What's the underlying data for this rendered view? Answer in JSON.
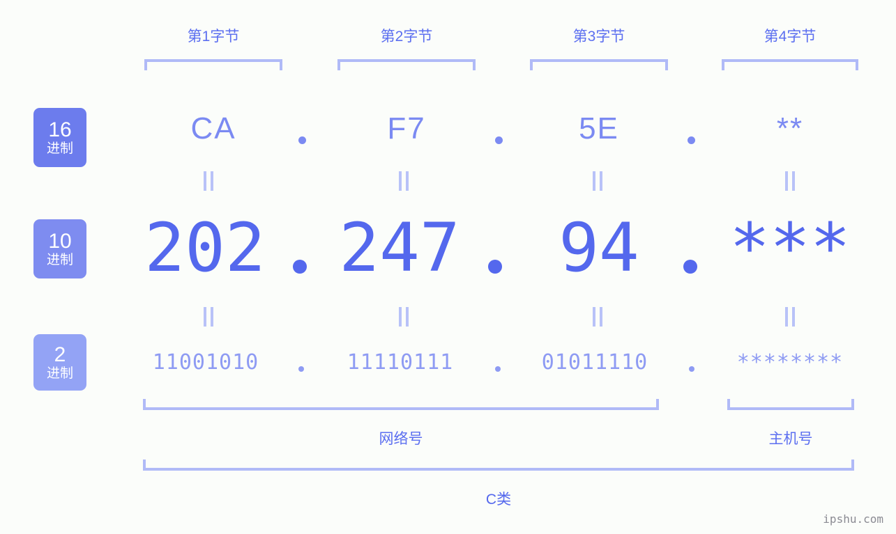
{
  "page": {
    "background_color": "#fbfdfa",
    "accent_color": "#5468ed",
    "light_accent_color": "#b0baf7",
    "watermark": "ipshu.com"
  },
  "byte_headers": [
    {
      "label": "第1字节"
    },
    {
      "label": "第2字节"
    },
    {
      "label": "第3字节"
    },
    {
      "label": "第4字节"
    }
  ],
  "rows": {
    "hex": {
      "badge_number": "16",
      "badge_unit": "进制",
      "badge_color": "#6c7ced",
      "values": [
        "CA",
        "F7",
        "5E",
        "**"
      ],
      "separator": "."
    },
    "dec": {
      "badge_number": "10",
      "badge_unit": "进制",
      "badge_color": "#7e8cf0",
      "values": [
        "202",
        "247",
        "94",
        "***"
      ],
      "separator": "."
    },
    "bin": {
      "badge_number": "2",
      "badge_unit": "进制",
      "badge_color": "#93a3f5",
      "values": [
        "11001010",
        "11110111",
        "01011110",
        "********"
      ],
      "separator": "."
    }
  },
  "equality_marks": {
    "symbol": "‖",
    "count_per_row": 4
  },
  "sections": [
    {
      "label": "网络号",
      "name": "network-part"
    },
    {
      "label": "主机号",
      "name": "host-part"
    }
  ],
  "address_class": {
    "label": "C类"
  }
}
